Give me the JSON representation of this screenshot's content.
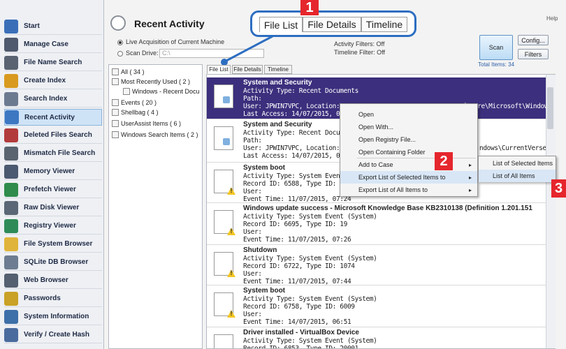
{
  "sidebar": {
    "items": [
      {
        "label": "Start",
        "icon": "start-icon",
        "color": "#3a6fb8"
      },
      {
        "label": "Manage Case",
        "icon": "case-icon",
        "color": "#4f5a6e"
      },
      {
        "label": "File Name Search",
        "icon": "car-search-icon",
        "color": "#5a6372"
      },
      {
        "label": "Create Index",
        "icon": "create-index-icon",
        "color": "#d89a1f"
      },
      {
        "label": "Search Index",
        "icon": "search-index-icon",
        "color": "#6c7a90"
      },
      {
        "label": "Recent Activity",
        "icon": "recent-activity-icon",
        "color": "#3d77c2"
      },
      {
        "label": "Deleted Files Search",
        "icon": "deleted-files-icon",
        "color": "#b23b3b"
      },
      {
        "label": "Mismatch File Search",
        "icon": "mismatch-icon",
        "color": "#5a6470"
      },
      {
        "label": "Memory Viewer",
        "icon": "memory-icon",
        "color": "#4b5a70"
      },
      {
        "label": "Prefetch Viewer",
        "icon": "prefetch-icon",
        "color": "#2f8c4c"
      },
      {
        "label": "Raw Disk Viewer",
        "icon": "raw-disk-icon",
        "color": "#5b6676"
      },
      {
        "label": "Registry Viewer",
        "icon": "registry-icon",
        "color": "#2e8b57"
      },
      {
        "label": "File System Browser",
        "icon": "folder-icon",
        "color": "#e0b43a"
      },
      {
        "label": "SQLite DB Browser",
        "icon": "sqlite-icon",
        "color": "#6d7c90"
      },
      {
        "label": "Web Browser",
        "icon": "web-icon",
        "color": "#556070"
      },
      {
        "label": "Passwords",
        "icon": "key-icon",
        "color": "#c9a227"
      },
      {
        "label": "System Information",
        "icon": "system-info-icon",
        "color": "#3d6fa8"
      },
      {
        "label": "Verify / Create Hash",
        "icon": "hash-icon",
        "color": "#4a6b9e"
      }
    ]
  },
  "header": {
    "help": "Help",
    "title": "Recent Activity",
    "live_label": "Live Acquisition of Current Machine",
    "scan_drive_label": "Scan Drive:",
    "scan_drive_value": "C:\\",
    "activity_filters": "Activity Filters: Off",
    "timeline_filter": "Timeline Filter: Off",
    "total_items": "Total Items: 34"
  },
  "big_tabs": [
    "File List",
    "File Details",
    "Timeline"
  ],
  "small_tabs": [
    "File List",
    "File Details",
    "Timeline"
  ],
  "badges": [
    "1",
    "2",
    "3"
  ],
  "buttons": {
    "scan": "Scan",
    "config": "Config...",
    "filters": "Filters"
  },
  "tree": [
    "All ( 34 )",
    "Most Recently Used ( 2 )",
    "Windows - Recent Docu",
    "Events ( 20 )",
    "Shellbag ( 4 )",
    "UserAssist Items ( 6 )",
    "Windows Search Items ( 2 )"
  ],
  "list": [
    {
      "title": "System and Security",
      "lines": [
        "Activity Type: Recent Documents",
        "Path:",
        "User: JPWIN7VPC,   Location: C:\\Users\\JPWIN7VPC\\NTUSER.DAT\\Software\\Microsoft\\Windows\\Cu",
        "Last Access: 14/07/2015, 08:1"
      ]
    },
    {
      "title": "System and Security",
      "lines": [
        "Activity Type: Recent Documen",
        "Path:",
        "User: JPWIN7VPC,   Location:",
        "Last Access: 14/07/2015, 08:1"
      ]
    },
    {
      "title": "System boot",
      "lines": [
        "Activity Type: System Event (",
        "Record ID: 6588,    Type ID: 60",
        "User:",
        "Event Time: 11/07/2015, 07:24"
      ]
    },
    {
      "title": "Windows update success - Microsoft Knowledge Base  KB2310138 (Definition 1.201.151",
      "lines": [
        "Activity Type: System Event (System)",
        "Record ID: 6695,    Type ID: 19",
        "User:",
        "Event Time: 11/07/2015, 07:26"
      ]
    },
    {
      "title": "Shutdown",
      "lines": [
        "Activity Type: System Event (System)",
        "Record ID: 6722,    Type ID: 1074",
        "User:",
        "Event Time: 11/07/2015, 07:44"
      ]
    },
    {
      "title": "System boot",
      "lines": [
        "Activity Type: System Event (System)",
        "Record ID: 6758,    Type ID: 6009",
        "User:",
        "Event Time: 14/07/2015, 06:51"
      ]
    },
    {
      "title": "Driver installed - VirtualBox Device",
      "lines": [
        "Activity Type: System Event (System)",
        "Record ID: 6853,    Type ID: 20001"
      ]
    }
  ],
  "list_extra": {
    "row2_location_tail": "ndows\\CurrentVerser"
  },
  "context_menu": [
    {
      "label": "Open",
      "arrow": ""
    },
    {
      "label": "Open With...",
      "arrow": ""
    },
    {
      "label": "Open Registry File...",
      "arrow": ""
    },
    {
      "label": "Open Containing Folder",
      "arrow": ""
    },
    {
      "label": "Add to Case",
      "arrow": "▸"
    },
    {
      "label": "Export List of Selected Items to",
      "arrow": "▸"
    },
    {
      "label": "Export List of All Items to",
      "arrow": "▸"
    }
  ],
  "submenu": [
    "List of Selected Items",
    "List of All Items"
  ]
}
